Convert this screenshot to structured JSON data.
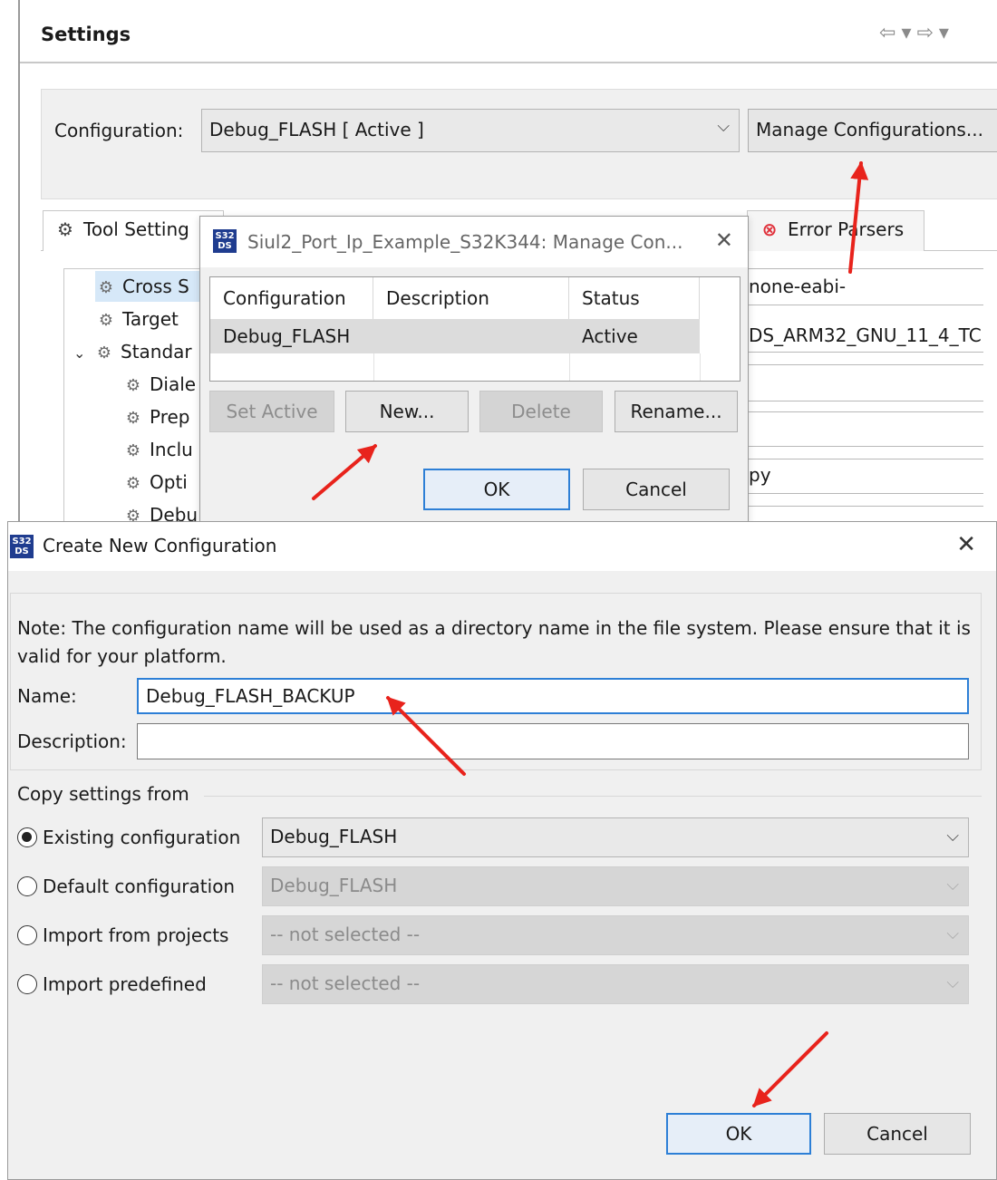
{
  "settings": {
    "title": "Settings",
    "nav_back": "⇦",
    "nav_dropdown": "▾",
    "nav_forward": "⇨",
    "configuration_label": "Configuration:",
    "configuration_value": "Debug_FLASH  [ Active ]",
    "manage_button": "Manage Configurations...",
    "tabs": [
      {
        "label": "Tool Setting"
      },
      {
        "label": "Error Parsers"
      }
    ],
    "tree": [
      {
        "label": "Cross S"
      },
      {
        "label": "Target"
      },
      {
        "label": "Standar"
      },
      {
        "label": "Diale"
      },
      {
        "label": "Prep"
      },
      {
        "label": "Inclu"
      },
      {
        "label": "Opti"
      },
      {
        "label": "Debu"
      }
    ],
    "right_fields": [
      {
        "text": "none-eabi-"
      },
      {
        "text": "DS_ARM32_GNU_11_4_TC"
      },
      {
        "text": "py"
      }
    ]
  },
  "manage_dialog": {
    "title": "Siul2_Port_Ip_Example_S32K344: Manage Con...",
    "columns": [
      "Configuration",
      "Description",
      "Status"
    ],
    "rows": [
      {
        "configuration": "Debug_FLASH",
        "description": "",
        "status": "Active"
      }
    ],
    "buttons": {
      "set_active": "Set Active",
      "new": "New...",
      "delete": "Delete",
      "rename": "Rename...",
      "ok": "OK",
      "cancel": "Cancel"
    }
  },
  "create_dialog": {
    "title": "Create New Configuration",
    "note": "Note: The configuration name will be used as a directory name in the file system.  Please ensure that it is valid for your platform.",
    "name_label": "Name:",
    "name_value": "Debug_FLASH_BACKUP",
    "description_label": "Description:",
    "description_value": "",
    "copy_group_label": "Copy settings from",
    "options": [
      {
        "label": "Existing configuration",
        "value": "Debug_FLASH",
        "checked": true,
        "enabled": true
      },
      {
        "label": "Default configuration",
        "value": "Debug_FLASH",
        "checked": false,
        "enabled": false
      },
      {
        "label": "Import from projects",
        "value": "-- not selected --",
        "checked": false,
        "enabled": false
      },
      {
        "label": "Import predefined",
        "value": "-- not selected --",
        "checked": false,
        "enabled": false
      }
    ],
    "ok": "OK",
    "cancel": "Cancel"
  },
  "logo_text": "S32\nDS",
  "colors": {
    "accent_blue": "#2d7fd6",
    "annotation_red": "#e8231c",
    "ds_logo": "#1f3c8f"
  }
}
